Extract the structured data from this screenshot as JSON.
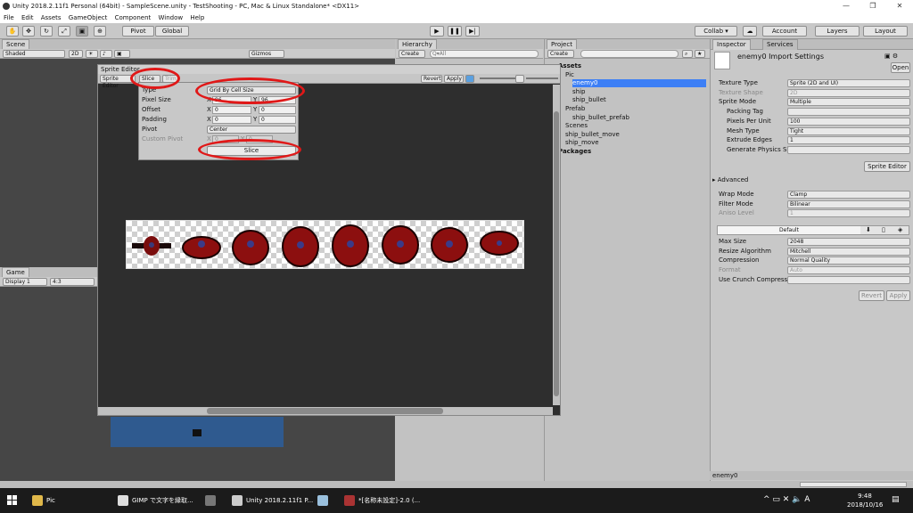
{
  "window": {
    "title": "Unity 2018.2.11f1 Personal (64bit) - SampleScene.unity - TestShooting - PC, Mac & Linux Standalone* <DX11>"
  },
  "menu": [
    "File",
    "Edit",
    "Assets",
    "GameObject",
    "Component",
    "Window",
    "Help"
  ],
  "toolbar": {
    "pivot": "Pivot",
    "global": "Global",
    "collab": "Collab ▾",
    "account": "Account",
    "layers": "Layers",
    "layout": "Layout"
  },
  "scene": {
    "tab": "Scene",
    "shading": "Shaded",
    "mode2d": "2D",
    "gizmos": "Gizmos"
  },
  "game": {
    "tab": "Game",
    "display": "Display 1",
    "aspect": "4:3"
  },
  "hierarchy": {
    "tab": "Hierarchy",
    "create": "Create",
    "search_placeholder": "Q▾All"
  },
  "project": {
    "tab": "Project",
    "create": "Create",
    "items": [
      {
        "label": "Assets",
        "indent": 0,
        "bold": true
      },
      {
        "label": "Pic",
        "indent": 1
      },
      {
        "label": "enemy0",
        "indent": 2,
        "selected": true
      },
      {
        "label": "ship",
        "indent": 2
      },
      {
        "label": "ship_bullet",
        "indent": 2
      },
      {
        "label": "Prefab",
        "indent": 1
      },
      {
        "label": "ship_bullet_prefab",
        "indent": 2
      },
      {
        "label": "Scenes",
        "indent": 1
      },
      {
        "label": "ship_bullet_move",
        "indent": 1
      },
      {
        "label": "ship_move",
        "indent": 1
      },
      {
        "label": "Packages",
        "indent": 0,
        "bold": true
      }
    ]
  },
  "sprite_editor": {
    "title": "Sprite Editor",
    "mode": "Sprite Editor",
    "slice": "Slice",
    "trim": "Trim",
    "revert": "Revert",
    "apply": "Apply",
    "popup": {
      "type_label": "Type",
      "type_value": "Grid By Cell Size",
      "pixel_size_label": "Pixel Size",
      "px_x": "96",
      "px_y": "96",
      "offset_label": "Offset",
      "off_x": "0",
      "off_y": "0",
      "padding_label": "Padding",
      "pad_x": "0",
      "pad_y": "0",
      "pivot_label": "Pivot",
      "pivot_value": "Center",
      "custom_pivot_label": "Custom Pivot",
      "cp_x": "0",
      "cp_y": "0",
      "slice_button": "Slice",
      "x": "X",
      "y": "Y"
    }
  },
  "inspector": {
    "tab": "Inspector",
    "services_tab": "Services",
    "title": "enemy0 Import Settings",
    "open": "Open",
    "fields": [
      {
        "label": "Texture Type",
        "value": "Sprite (2D and UI)"
      },
      {
        "label": "Texture Shape",
        "value": "2D",
        "disabled": true
      },
      {
        "label": "Sprite Mode",
        "value": "Multiple"
      },
      {
        "label": "Packing Tag",
        "value": "",
        "indent": true
      },
      {
        "label": "Pixels Per Unit",
        "value": "100",
        "indent": true
      },
      {
        "label": "Mesh Type",
        "value": "Tight",
        "indent": true
      },
      {
        "label": "Extrude Edges",
        "value": "1",
        "indent": true
      },
      {
        "label": "Generate Physics Sh",
        "value": "",
        "indent": true
      }
    ],
    "sprite_editor_button": "Sprite Editor",
    "advanced": "Advanced",
    "fields2": [
      {
        "label": "Wrap Mode",
        "value": "Clamp"
      },
      {
        "label": "Filter Mode",
        "value": "Bilinear"
      },
      {
        "label": "Aniso Level",
        "value": "1",
        "disabled": true
      }
    ],
    "platform_default": "Default",
    "fields3": [
      {
        "label": "Max Size",
        "value": "2048"
      },
      {
        "label": "Resize Algorithm",
        "value": "Mitchell"
      },
      {
        "label": "Compression",
        "value": "Normal Quality"
      },
      {
        "label": "Format",
        "value": "Auto",
        "disabled": true
      },
      {
        "label": "Use Crunch Compressio",
        "value": ""
      }
    ],
    "revert": "Revert",
    "apply": "Apply",
    "footer": "enemy0"
  },
  "taskbar": {
    "items": [
      {
        "label": "Pic",
        "color": "#e0b84a"
      },
      {
        "label": "GIMP で文字を縁取...",
        "color": "#dddddd"
      },
      {
        "label": "",
        "color": "#777777"
      },
      {
        "label": "Unity 2018.2.11f1 P...",
        "color": "#cccccc"
      },
      {
        "label": "",
        "color": "#9ac0dd"
      },
      {
        "label": "*[名称未設定]-2.0 (...",
        "color": "#aa3333"
      }
    ],
    "time": "9:48",
    "date": "2018/10/16"
  },
  "colors": {
    "selection": "#3d7ff5",
    "highlight": "#e01818",
    "scene_bg": "#464646",
    "game_bg": "#2f5a8f"
  }
}
